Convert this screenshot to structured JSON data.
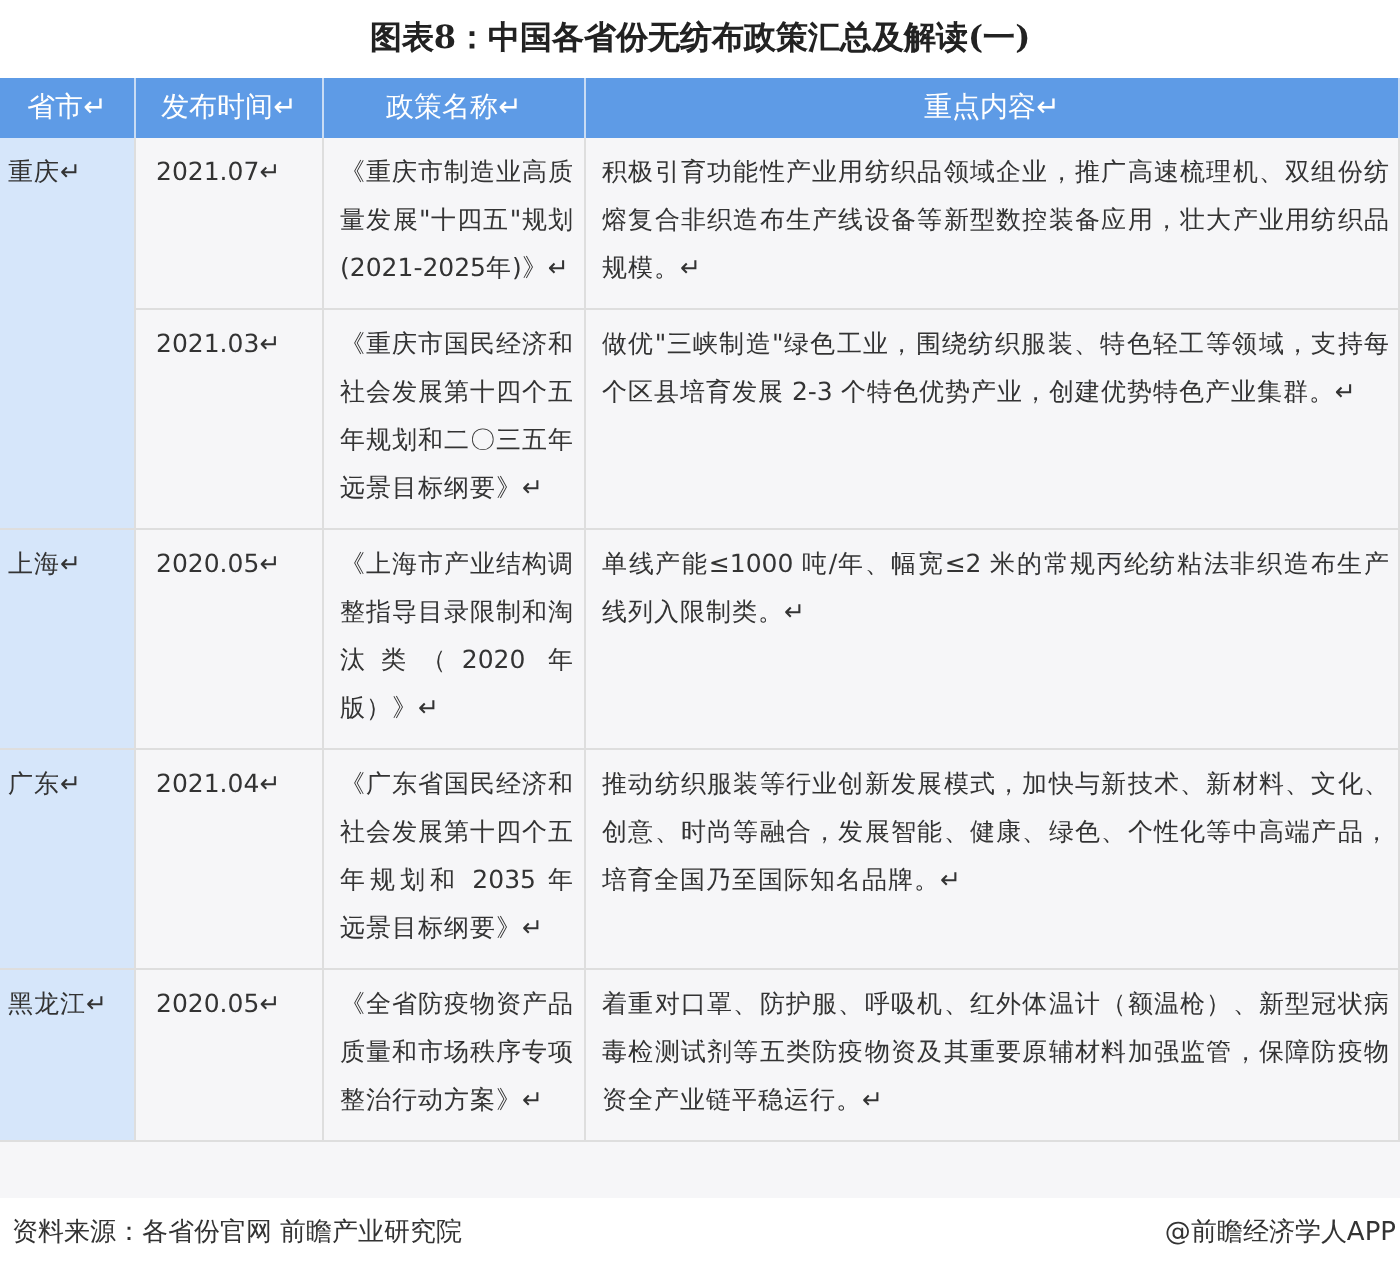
{
  "title": "图表8：中国各省份无纺布政策汇总及解读(一)",
  "table": {
    "columns": [
      "省市↵",
      "发布时间↵",
      "政策名称↵",
      "重点内容↵"
    ],
    "rows": [
      {
        "region": "重庆↵",
        "date": "2021.07↵",
        "policy": "《重庆市制造业高质量发展\"十四五\"规划(2021-2025年)》↵",
        "content": "积极引育功能性产业用纺织品领域企业，推广高速梳理机、双组份纺熔复合非织造布生产线设备等新型数控装备应用，壮大产业用纺织品规模。↵"
      },
      {
        "date": "2021.03↵",
        "policy": "《重庆市国民经济和社会发展第十四个五年规划和二〇三五年远景目标纲要》↵",
        "content": "做优\"三峡制造\"绿色工业，围绕纺织服装、特色轻工等领域，支持每个区县培育发展 2-3 个特色优势产业，创建优势特色产业集群。↵"
      },
      {
        "region": "上海↵",
        "date": "2020.05↵",
        "policy": "《上海市产业结构调整指导目录限制和淘汰类（2020 年版）》↵",
        "content": "单线产能≤1000 吨/年、幅宽≤2 米的常规丙纶纺粘法非织造布生产线列入限制类。↵"
      },
      {
        "region": "广东↵",
        "date": "2021.04↵",
        "policy": "《广东省国民经济和社会发展第十四个五年规划和 2035 年远景目标纲要》↵",
        "content": "推动纺织服装等行业创新发展模式，加快与新技术、新材料、文化、创意、时尚等融合，发展智能、健康、绿色、个性化等中高端产品，培育全国乃至国际知名品牌。↵"
      },
      {
        "region": "黑龙江↵",
        "date": "2020.05↵",
        "policy": "《全省防疫物资产品质量和市场秩序专项整治行动方案》↵",
        "content": "着重对口罩、防护服、呼吸机、红外体温计（额温枪）、新型冠状病毒检测试剂等五类防疫物资及其重要原辅材料加强监管，保障防疫物资全产业链平稳运行。↵"
      }
    ]
  },
  "footer": {
    "source": "资料来源：各省份官网 前瞻产业研究院",
    "credit": "@前瞻经济学人APP"
  }
}
